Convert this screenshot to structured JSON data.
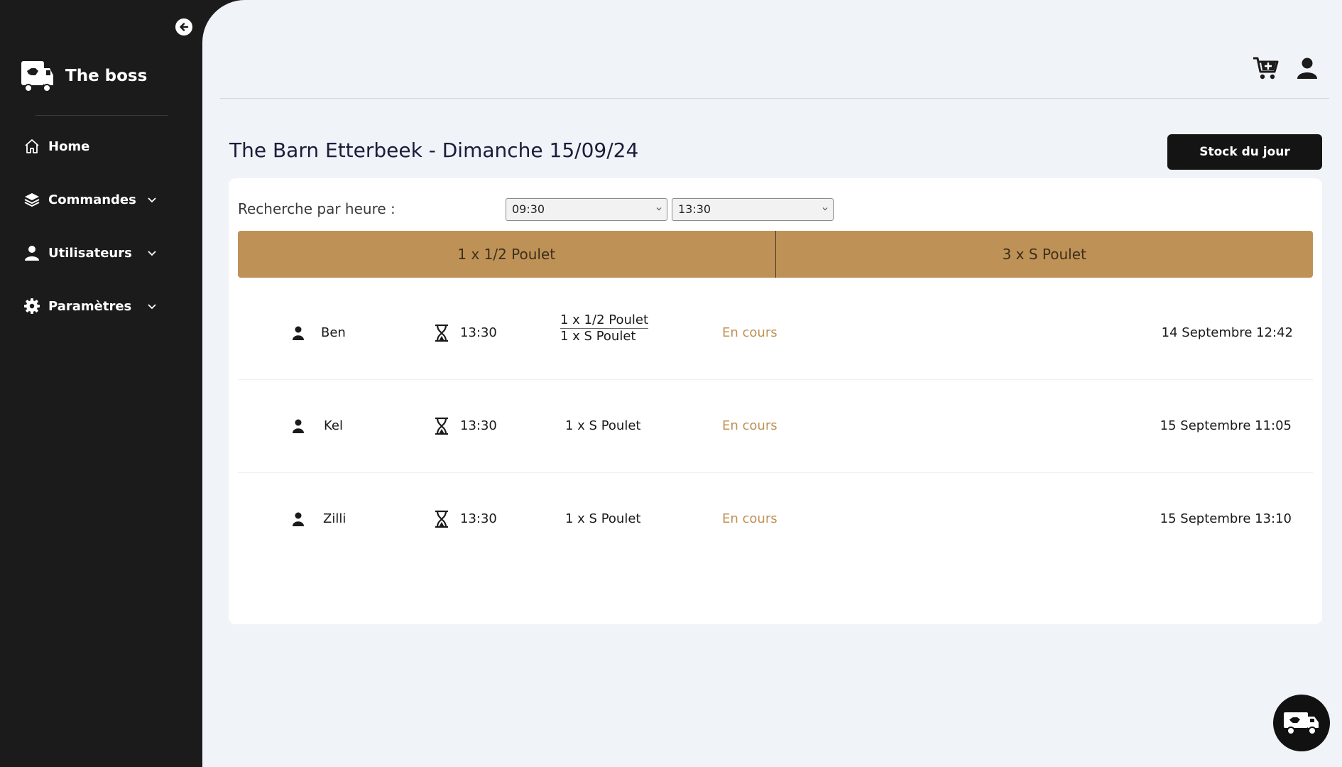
{
  "sidebar": {
    "brand_name": "The boss",
    "items": [
      {
        "label": "Home",
        "icon": "home-icon"
      },
      {
        "label": "Commandes",
        "icon": "layers-icon"
      },
      {
        "label": "Utilisateurs",
        "icon": "user-icon"
      },
      {
        "label": "Paramètres",
        "icon": "gear-icon"
      }
    ]
  },
  "header": {
    "title": "The Barn Etterbeek  - Dimanche 15/09/24",
    "stock_button": "Stock du jour"
  },
  "search": {
    "label": "Recherche par heure :",
    "from_value": "09:30",
    "to_value": "13:30"
  },
  "summary": [
    "1 x 1/2 Poulet",
    "3 x S Poulet"
  ],
  "orders": [
    {
      "name": "Ben",
      "time": "13:30",
      "items": [
        "1 x  1/2 Poulet",
        "1 x  S Poulet"
      ],
      "status": "En cours",
      "created": "14 Septembre  12:42"
    },
    {
      "name": "Kel",
      "time": "13:30",
      "items": [
        "1 x  S Poulet"
      ],
      "status": "En cours",
      "created": "15 Septembre  11:05"
    },
    {
      "name": "Zilli",
      "time": "13:30",
      "items": [
        "1 x  S Poulet"
      ],
      "status": "En cours",
      "created": "15 Septembre  13:10"
    }
  ],
  "colors": {
    "sidebar": "#1b1b1b",
    "accent": "#be9256",
    "background": "#f0f3f8"
  }
}
